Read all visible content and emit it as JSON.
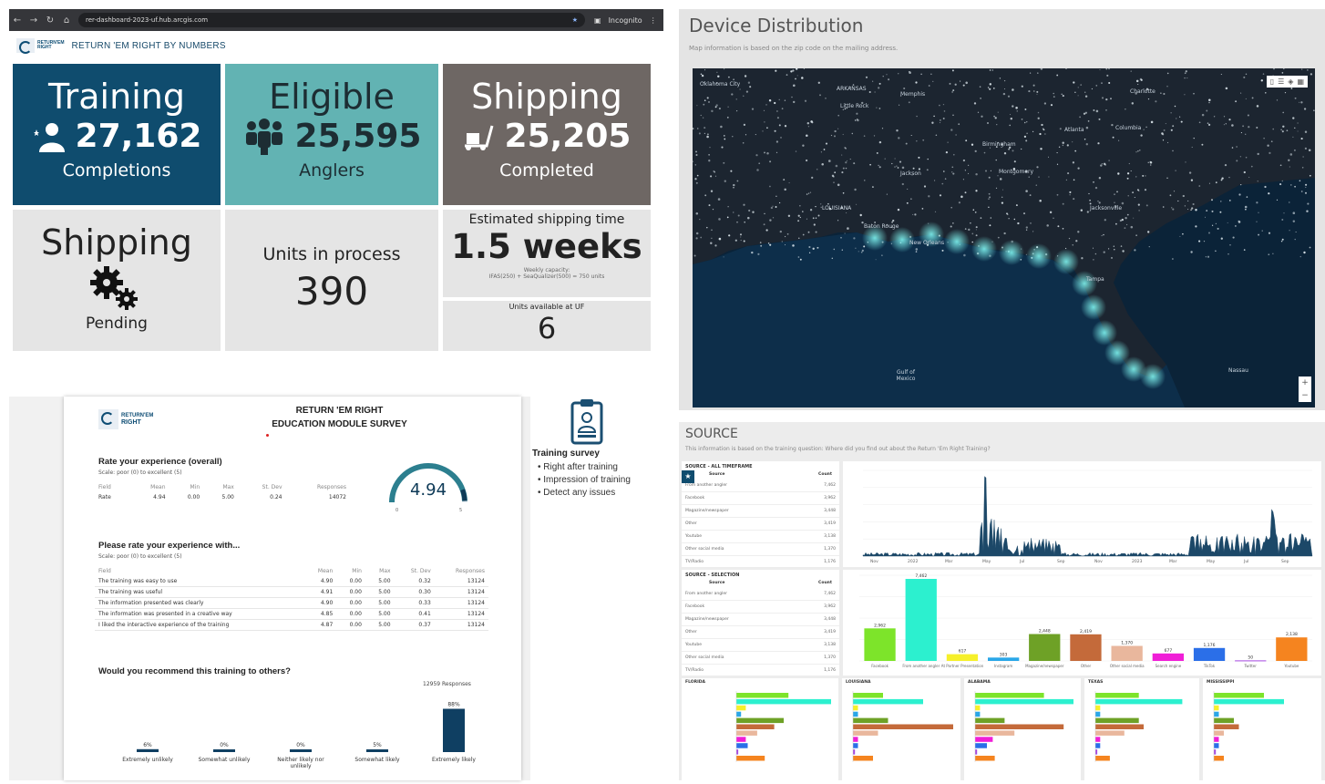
{
  "browser": {
    "url": "rer-dashboard-2023-uf.hub.arcgis.com",
    "nav_back": "←",
    "nav_forward": "→",
    "nav_reload": "↻",
    "mode": "Incognito"
  },
  "dashboard": {
    "title": "RETURN 'EM RIGHT BY NUMBERS",
    "logo_text_1": "RETURN'EM",
    "logo_text_2": "RIGHT",
    "tiles": {
      "training": {
        "title": "Training",
        "value": "27,162",
        "label": "Completions"
      },
      "eligible": {
        "title": "Eligible",
        "value": "25,595",
        "label": "Anglers"
      },
      "shipping": {
        "title": "Shipping",
        "value": "25,205",
        "label": "Completed"
      },
      "pending": {
        "title": "Shipping",
        "label": "Pending"
      },
      "units": {
        "title": "Units in process",
        "value": "390"
      },
      "estimate": {
        "title": "Estimated shipping time",
        "value": "1.5 weeks",
        "note_1": "Weekly capacity:",
        "note_2": "IFAS(250) + SeaQualizer(500) = 750 units"
      },
      "available": {
        "title": "Units available at UF",
        "value": "6"
      }
    }
  },
  "map": {
    "title": "Device Distribution",
    "subtitle": "Map information is based on the zip code on the mailing address.",
    "labels": [
      "Oklahoma City",
      "ARKANSAS",
      "Memphis",
      "Little Rock",
      "Birmingham",
      "Atlanta",
      "Charlotte",
      "Columbia",
      "Jackson",
      "Montgomery",
      "LOUISIANA",
      "Baton Rouge",
      "New Orleans",
      "Jacksonville",
      "Tampa",
      "Gulf of Mexico",
      "Nassau"
    ],
    "controls": [
      "bookmark-icon",
      "list-icon",
      "layers-icon",
      "grid-icon"
    ],
    "zoom_in": "+",
    "zoom_out": "−"
  },
  "survey": {
    "logo_text_1": "RETURN'EM",
    "logo_text_2": "RIGHT",
    "title_1": "RETURN 'EM RIGHT",
    "title_2": "EDUCATION MODULE SURVEY",
    "overall": {
      "heading": "Rate your experience (overall)",
      "scale": "Scale: poor (0) to excellent (5)",
      "columns": [
        "Field",
        "Mean",
        "Min",
        "Max",
        "St. Dev",
        "Responses"
      ],
      "row": [
        "Rate",
        "4.94",
        "0.00",
        "5.00",
        "0.24",
        "14072"
      ],
      "gauge_value": "4.94",
      "gauge_fraction": 0.988,
      "gauge_min": "0",
      "gauge_max": "5"
    },
    "detail": {
      "heading": "Please rate your experience with...",
      "scale": "Scale: poor (0) to excellent (5)",
      "columns": [
        "Field",
        "Mean",
        "Min",
        "Max",
        "St. Dev",
        "Responses"
      ],
      "rows": [
        [
          "The training was easy to use",
          "4.90",
          "0.00",
          "5.00",
          "0.32",
          "13124"
        ],
        [
          "The training was useful",
          "4.91",
          "0.00",
          "5.00",
          "0.30",
          "13124"
        ],
        [
          "The information presented was clearly",
          "4.90",
          "0.00",
          "5.00",
          "0.33",
          "13124"
        ],
        [
          "The information was presented in a creative way",
          "4.85",
          "0.00",
          "5.00",
          "0.41",
          "13124"
        ],
        [
          "I liked the interactive experience of the training",
          "4.87",
          "0.00",
          "5.00",
          "0.37",
          "13124"
        ]
      ]
    },
    "recommend": {
      "heading": "Would you recommend this training to others?",
      "responses": "12959 Responses",
      "bars": [
        {
          "label": "Extremely unlikely",
          "pct": "6%",
          "value": 6
        },
        {
          "label": "Somewhat unlikely",
          "pct": "0%",
          "value": 0
        },
        {
          "label": "Neither likely nor unlikely",
          "pct": "0%",
          "value": 0
        },
        {
          "label": "Somewhat likely",
          "pct": "5%",
          "value": 5
        },
        {
          "label": "Extremely likely",
          "pct": "88%",
          "value": 88
        }
      ]
    }
  },
  "training_survey": {
    "title": "Training survey",
    "items": [
      "• Right after training",
      "• Impression of training",
      "• Detect any issues"
    ]
  },
  "source": {
    "title": "SOURCE",
    "subtitle": "This information is based on the training question: Where did you find out about the Return 'Em Right Training?",
    "all_timeframe": {
      "title": "SOURCE - ALL TIMEFRAME",
      "col_source": "Source",
      "col_count": "Count",
      "rows": [
        [
          "From another angler",
          "7,462"
        ],
        [
          "Facebook",
          "3,962"
        ],
        [
          "Magazine/newspaper",
          "3,448"
        ],
        [
          "Other",
          "3,419"
        ],
        [
          "Youtube",
          "3,138"
        ],
        [
          "Other social media",
          "1,370"
        ],
        [
          "TV/Radio",
          "1,176"
        ]
      ]
    },
    "selection": {
      "title": "SOURCE - SELECTION",
      "col_source": "Source",
      "col_count": "Count",
      "rows": [
        [
          "From another angler",
          "7,462"
        ],
        [
          "Facebook",
          "3,962"
        ],
        [
          "Magazine/newspaper",
          "3,448"
        ],
        [
          "Other",
          "3,419"
        ],
        [
          "Youtube",
          "3,138"
        ],
        [
          "Other social media",
          "1,370"
        ],
        [
          "TV/Radio",
          "1,176"
        ]
      ]
    },
    "timeseries_x": [
      "Nov",
      "2022",
      "Mar",
      "May",
      "Jul",
      "Sep",
      "Nov",
      "2023",
      "Mar",
      "May",
      "Jul",
      "Sep"
    ],
    "bar_colors": [
      "#7de42a",
      "#2cf0cf",
      "#f6f02a",
      "#2aa7e8",
      "#6ea126",
      "#c46a3a",
      "#e9b79d",
      "#f01ed7",
      "#2b6fe8",
      "#a548e0",
      "#f5841f"
    ],
    "states": [
      "FLORIDA",
      "LOUISIANA",
      "ALABAMA",
      "TEXAS",
      "MISSISSIPPI"
    ]
  },
  "chart_data": [
    {
      "type": "bar",
      "categories": [
        "Extremely unlikely",
        "Somewhat unlikely",
        "Neither likely nor unlikely",
        "Somewhat likely",
        "Extremely likely"
      ],
      "values": [
        6,
        0,
        0,
        5,
        88
      ],
      "title": "Would you recommend this training to others?",
      "ylim": [
        0,
        100
      ]
    },
    {
      "type": "bar",
      "categories": [
        "Facebook",
        "From another angler",
        "At Partner Presentation",
        "Instagram",
        "Magazine/newspaper",
        "Other",
        "Other social media",
        "Search engine",
        "TikTok",
        "Twitter",
        "Youtube"
      ],
      "values": [
        2962,
        7462,
        617,
        303,
        2448,
        2419,
        1370,
        677,
        1176,
        50,
        2138
      ],
      "title": "SOURCE - SELECTION"
    }
  ]
}
